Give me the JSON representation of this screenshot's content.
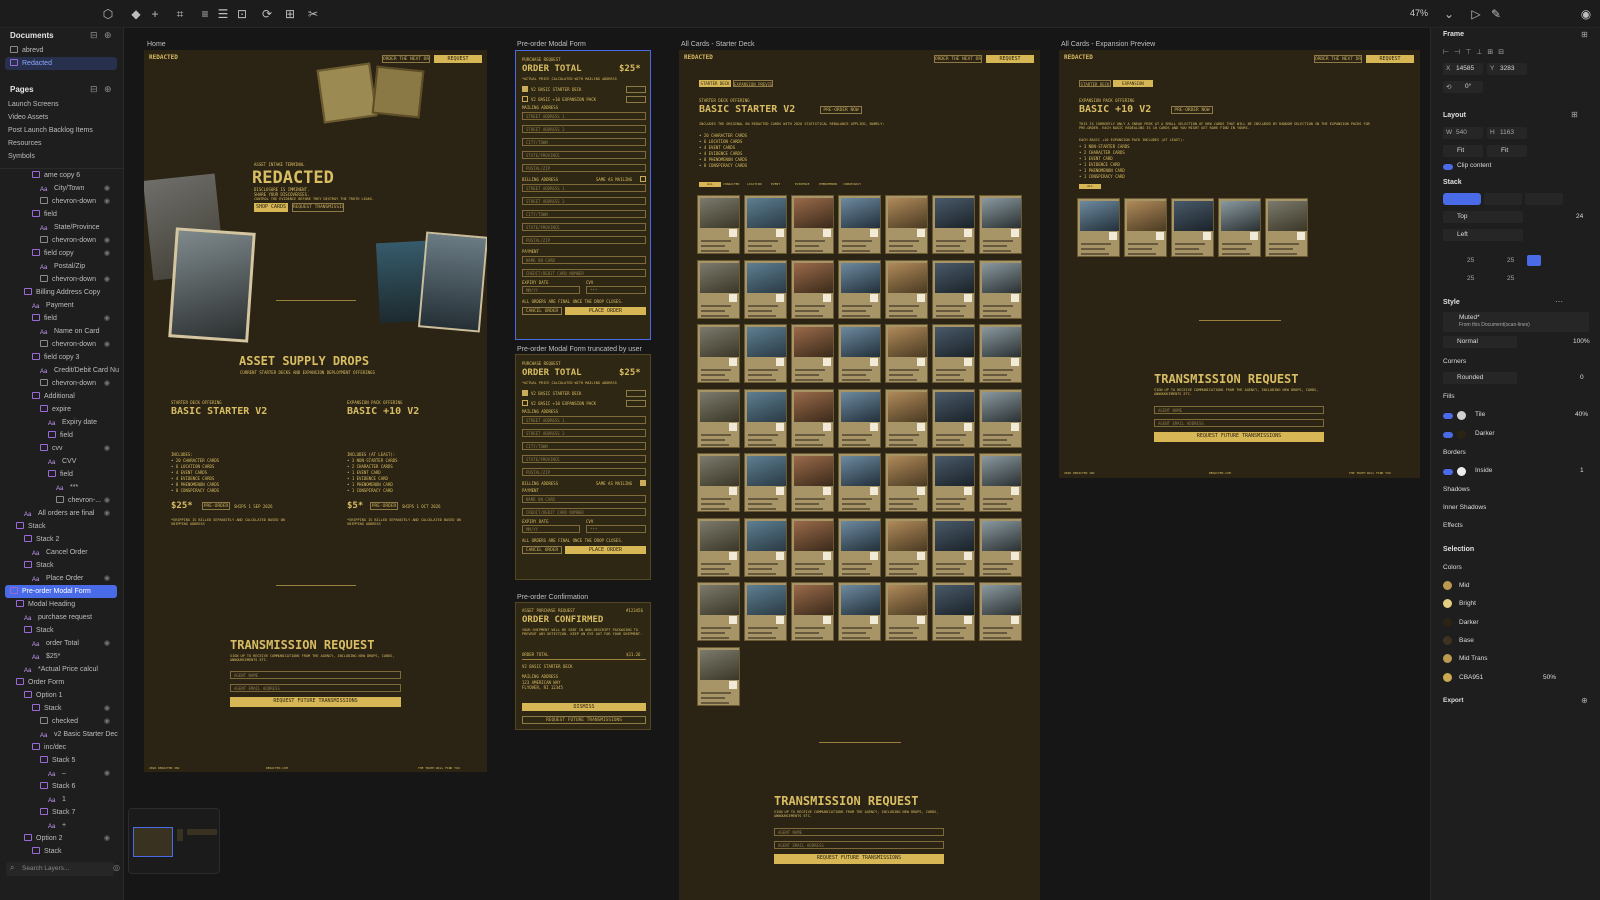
{
  "app": {
    "zoom": "47%"
  },
  "left_panel": {
    "documents_title": "Documents",
    "documents": [
      "abrevd",
      "Redacted"
    ],
    "pages_title": "Pages",
    "pages": [
      "Launch Screens",
      "Video Assets",
      "Post Launch Backlog Items",
      "Resources",
      "Symbols"
    ],
    "layers": [
      {
        "label": "ame copy 6",
        "depth": 3,
        "kind": "frame"
      },
      {
        "label": "City/Town",
        "depth": 4,
        "kind": "text"
      },
      {
        "label": "chevron-down",
        "depth": 4,
        "kind": "comp"
      },
      {
        "label": "field",
        "depth": 3,
        "kind": "frame"
      },
      {
        "label": "State/Province",
        "depth": 4,
        "kind": "text"
      },
      {
        "label": "chevron-down",
        "depth": 4,
        "kind": "comp"
      },
      {
        "label": "field copy",
        "depth": 3,
        "kind": "frame"
      },
      {
        "label": "Postal/Zip",
        "depth": 4,
        "kind": "text"
      },
      {
        "label": "chevron-down",
        "depth": 4,
        "kind": "comp"
      },
      {
        "label": "Billing Address Copy",
        "depth": 2,
        "kind": "frame"
      },
      {
        "label": "Payment",
        "depth": 3,
        "kind": "text"
      },
      {
        "label": "field",
        "depth": 3,
        "kind": "frame"
      },
      {
        "label": "Name on Card",
        "depth": 4,
        "kind": "text"
      },
      {
        "label": "chevron-down",
        "depth": 4,
        "kind": "comp"
      },
      {
        "label": "field copy 3",
        "depth": 3,
        "kind": "frame"
      },
      {
        "label": "Credit/Debit Card Nu",
        "depth": 4,
        "kind": "text"
      },
      {
        "label": "chevron-down",
        "depth": 4,
        "kind": "comp"
      },
      {
        "label": "Additional",
        "depth": 3,
        "kind": "frame"
      },
      {
        "label": "expire",
        "depth": 4,
        "kind": "frame"
      },
      {
        "label": "Expiry date",
        "depth": 5,
        "kind": "text"
      },
      {
        "label": "field",
        "depth": 5,
        "kind": "frame"
      },
      {
        "label": "cvv",
        "depth": 4,
        "kind": "frame"
      },
      {
        "label": "CVV",
        "depth": 5,
        "kind": "text"
      },
      {
        "label": "field",
        "depth": 5,
        "kind": "frame"
      },
      {
        "label": "***",
        "depth": 6,
        "kind": "text"
      },
      {
        "label": "chevron-...",
        "depth": 6,
        "kind": "comp"
      },
      {
        "label": "All orders are final",
        "depth": 2,
        "kind": "text"
      },
      {
        "label": "Stack",
        "depth": 1,
        "kind": "frame"
      },
      {
        "label": "Stack 2",
        "depth": 2,
        "kind": "frame"
      },
      {
        "label": "Cancel Order",
        "depth": 3,
        "kind": "text"
      },
      {
        "label": "Stack",
        "depth": 2,
        "kind": "frame"
      },
      {
        "label": "Place Order",
        "depth": 3,
        "kind": "text"
      },
      {
        "label": "Pre-order Modal Form",
        "depth": 0,
        "kind": "frame",
        "selected": true
      },
      {
        "label": "Modal Heading",
        "depth": 1,
        "kind": "frame"
      },
      {
        "label": "purchase request",
        "depth": 2,
        "kind": "text"
      },
      {
        "label": "Stack",
        "depth": 2,
        "kind": "frame"
      },
      {
        "label": "order Total",
        "depth": 3,
        "kind": "text"
      },
      {
        "label": "$25*",
        "depth": 3,
        "kind": "text"
      },
      {
        "label": "*Actual Price calcul",
        "depth": 2,
        "kind": "text"
      },
      {
        "label": "Order Form",
        "depth": 1,
        "kind": "frame"
      },
      {
        "label": "Option 1",
        "depth": 2,
        "kind": "frame"
      },
      {
        "label": "Stack",
        "depth": 3,
        "kind": "frame"
      },
      {
        "label": "checked",
        "depth": 4,
        "kind": "comp"
      },
      {
        "label": "v2 Basic Starter Dec",
        "depth": 4,
        "kind": "text"
      },
      {
        "label": "inc/dec",
        "depth": 3,
        "kind": "frame"
      },
      {
        "label": "Stack 5",
        "depth": 4,
        "kind": "frame"
      },
      {
        "label": "–",
        "depth": 5,
        "kind": "text"
      },
      {
        "label": "Stack 6",
        "depth": 4,
        "kind": "frame"
      },
      {
        "label": "1",
        "depth": 5,
        "kind": "text"
      },
      {
        "label": "Stack 7",
        "depth": 4,
        "kind": "frame"
      },
      {
        "label": "+",
        "depth": 5,
        "kind": "text"
      },
      {
        "label": "Option 2",
        "depth": 2,
        "kind": "frame"
      },
      {
        "label": "Stack",
        "depth": 3,
        "kind": "frame"
      }
    ],
    "search_placeholder": "Search Layers..."
  },
  "canvas": {
    "frame_labels": {
      "home": "Home",
      "modal_form": "Pre-order Modal Form",
      "modal_truncated": "Pre-order Modal Form truncated by user",
      "confirmation": "Pre-order Confirmation",
      "starter": "All Cards - Starter Deck",
      "expansion": "All Cards - Expansion Preview"
    },
    "site": {
      "logo": "REDACTED",
      "nav_drop": "ORDER THE NEXT DROP",
      "nav_request": "REQUEST TRANSMISSION",
      "hero_kicker": "ASSET INTAKE TERMINAL",
      "hero_title": "REDACTED",
      "hero_sub1": "DISCLOSURE IS IMMINENT.",
      "hero_sub2": "SHARE YOUR DISCOVERIES.",
      "hero_sub3": "CONTROL THE EVIDENCE BEFORE THEY DESTROY THE TRUTH LEAKS.",
      "shop_cards": "SHOP CARDS",
      "request_transmission": "REQUEST TRANSMISSION",
      "supply_title": "ASSET SUPPLY DROPS",
      "supply_sub": "CURRENT STARTER DECKS AND EXPANSION DEPLOYMENT OFFERINGS",
      "starter_kicker": "STARTER DECK OFFERING",
      "starter_title": "BASIC STARTER V2",
      "expansion_kicker": "EXPANSION PACK OFFERING",
      "expansion_title": "BASIC +10 V2",
      "includes": "INCLUDES:",
      "includes_least": "INCLUDES (AT LEAST):",
      "starter_items": [
        "• 20 CHARACTER CARDS",
        "• 6 LOCATION CARDS",
        "• 4 EVENT CARDS",
        "• 4 EVIDENCE CARDS",
        "• 8 PHENOMENON CARDS",
        "• 8 CONSPIRACY CARDS"
      ],
      "expansion_items": [
        "• 3 NON-STARTER CARDS",
        "• 2 CHARACTER CARDS",
        "• 1 EVENT CARD",
        "• 1 EVIDENCE CARD",
        "• 1 PHENOMENON CARD",
        "• 1 CONSPIRACY CARD"
      ],
      "price_starter": "$25*",
      "price_expansion": "$5*",
      "preorder": "PRE-ORDER",
      "ships_starter": "SHIPS 1 SEP 2026",
      "ships_expansion": "SHIPS 1 OCT 2026",
      "shipping_note": "*SHIPPING IS BILLED SEPARATELY AND CALCULATED BASED ON SHIPPING ADDRESS",
      "transmission_title": "TRANSMISSION REQUEST",
      "transmission_sub": "SIGN UP TO RECEIVE COMMUNICATIONS FROM THE AGENCY, INCLUDING NEW DROPS, CARDS, ANNOUNCEMENTS ETC.",
      "agent_name": "AGENT NAME",
      "agent_email": "AGENT EMAIL ADDRESS",
      "request_future": "REQUEST FUTURE TRANSMISSIONS",
      "footer_left": "2026 REDACTED INC",
      "footer_mid": "REDACTED.COM",
      "footer_right": "THE TRUTH WILL FIND YOU"
    },
    "modal": {
      "kicker": "PURCHASE REQUEST",
      "total_label": "ORDER TOTAL",
      "total": "$25*",
      "price_note": "*ACTUAL PRICE CALCULATED WITH MAILING ADDRESS",
      "opt1": "V2 BASIC STARTER DECK",
      "opt2": "V2 BASIC +10 EXPANSION PACK",
      "mailing": "MAILING ADDRESS",
      "billing": "BILLING ADDRESS",
      "same_as": "SAME AS MAILING",
      "street1": "STREET ADDRESS 1",
      "street2": "STREET ADDRESS 2",
      "city": "CITY/TOWN",
      "state": "STATE/PROVINCE",
      "postal": "POSTAL/ZIP",
      "payment": "PAYMENT",
      "name_card": "NAME ON CARD",
      "card_number": "CREDIT/DEBIT CARD NUMBER",
      "expiry": "EXPIRY DATE",
      "cvv": "CVV",
      "mmyy": "MM/YY",
      "cvv_mask": "***",
      "final": "ALL ORDERS ARE FINAL ONCE THE DROP CLOSES.",
      "cancel": "CANCEL ORDER",
      "place": "PLACE ORDER"
    },
    "confirm": {
      "kicker": "ASSET PURCHASE REQUEST",
      "order_no": "#123456",
      "title": "ORDER CONFIRMED",
      "body": "YOUR SHIPMENT WILL BE SENT IN NON-DESCRIPT PACKAGING TO PREVENT ANY DETECTION. KEEP AN EYE OUT FOR YOUR SHIPMENT.",
      "total_label": "ORDER TOTAL",
      "total": "$31.26",
      "line": "V2 BASIC STARTER DECK",
      "mailing": "MAILING ADDRESS",
      "addr1": "123 AMERICAN WAY",
      "addr2": "FLYOVER, RI 12345",
      "dismiss": "DISMISS",
      "request": "REQUEST FUTURE TRANSMISSIONS"
    },
    "deck": {
      "tab_starter": "STARTER DECK",
      "tab_expansion": "EXPANSION PREVIEW",
      "kicker": "STARTER DECK OFFERING",
      "title": "BASIC STARTER V2",
      "preorder": "PRE-ORDER NOW",
      "desc": "INCLUDES THE ORIGINAL 80 REDACTED CARDS WITH 2026 STATISTICAL REBALANCE APPLIED, NAMELY:",
      "filters": [
        "ALL",
        "CHARACTER",
        "LOCATION",
        "EVENT",
        "EVIDENCE",
        "PHENOMENON",
        "CONSPIRACY"
      ]
    },
    "expansion": {
      "kicker": "EXPANSION PACK OFFERING",
      "title": "BASIC +10 V2",
      "preorder": "PRE-ORDER NOW",
      "desc": "THIS IS CURRENTLY ONLY A SNEAK PEEK AT A SMALL SELECTION OF NEW CARDS THAT WILL BE INCLUDED BY RANDOM SELECTION IN THE EXPANSION PACKS FOR PRE-ORDER. EACH BASIC REDEALING IS 10 CARDS AND YOU MIGHT GET RARE FIND IN YOURS.",
      "desc2": "EACH BASIC +10 EXPANSION PACK INCLUDES (AT LEAST):"
    }
  },
  "right_panel": {
    "frame_title": "Frame",
    "x_label": "X",
    "x": "14585",
    "y_label": "Y",
    "y": "3283",
    "rotation": "0°",
    "layout_title": "Layout",
    "w_label": "W",
    "w": "540",
    "h_label": "H",
    "h": "1163",
    "fit1": "Fit",
    "fit2": "Fit",
    "clip": "Clip content",
    "stack_title": "Stack",
    "align_top": "Top",
    "gap": "24",
    "align_left": "Left",
    "pad": [
      "25",
      "25",
      "25",
      "25"
    ],
    "style_title": "Style",
    "style_name": "Muted*",
    "style_source": "From this Document(scan-lines)",
    "blend": "Normal",
    "opacity": "100%",
    "corners_title": "Corners",
    "corners": "Rounded",
    "corner_val": "0",
    "fills_title": "Fills",
    "fill1": "Tile",
    "fill1_val": "40%",
    "fill2": "Darker",
    "borders_title": "Borders",
    "border": "Inside",
    "border_val": "1",
    "shadows": "Shadows",
    "inner_shadows": "Inner Shadows",
    "effects": "Effects",
    "selection_title": "Selection",
    "colors_title": "Colors",
    "colors": [
      {
        "name": "Mid",
        "hex": "#b99a4e"
      },
      {
        "name": "Bright",
        "hex": "#e6cd84"
      },
      {
        "name": "Darker",
        "hex": "#2c2412"
      },
      {
        "name": "Base",
        "hex": "#3d3320"
      },
      {
        "name": "Mid Trans",
        "hex": "#b99a4e"
      },
      {
        "name": "CBA951",
        "hex": "#cba951",
        "pct": "50%"
      }
    ],
    "export": "Export"
  }
}
